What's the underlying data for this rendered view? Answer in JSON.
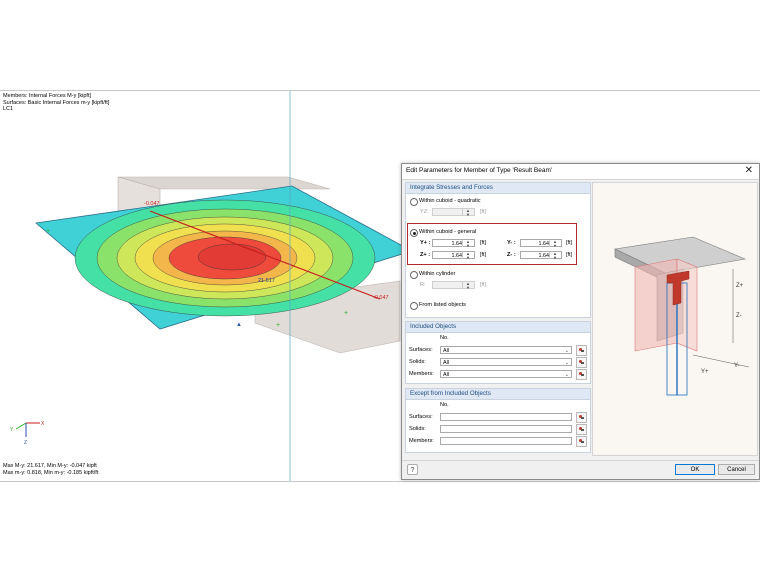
{
  "viewport": {
    "info_lines": [
      "Members: Internal Forces M-y [kipft]",
      "Surfaces: Basic Internal Forces m-y [kipft/ft]",
      "LC1"
    ],
    "labels": {
      "left_value": "-0.047",
      "center_value": "21.617",
      "right_value": "-0.047"
    },
    "footer_lines": [
      "Max M-y: 21.617, Min M-y: -0.047 kipft",
      "Max m-y: 0.818, Min m-y: -0.185 kipft/ft"
    ],
    "axes": {
      "x": "X",
      "y": "Y",
      "z": "Z"
    }
  },
  "dialog": {
    "title": "Edit Parameters for Member of Type 'Result Beam'",
    "close_glyph": "✕",
    "integrate_section": {
      "header": "Integrate Stresses and Forces",
      "quadratic": {
        "label": "Within cuboid - quadratic",
        "yz_label": "YZ:",
        "unit": "[ft]"
      },
      "general": {
        "label": "Within cuboid - general",
        "yplus_label": "Y+ :",
        "yplus_value": "1.64",
        "yplus_unit": "[ft]",
        "yminus_label": "Y- :",
        "yminus_value": "1.64",
        "yminus_unit": "[ft]",
        "zplus_label": "Z+ :",
        "zplus_value": "1.64",
        "zplus_unit": "[ft]",
        "zminus_label": "Z- :",
        "zminus_value": "1.64",
        "zminus_unit": "[ft]"
      },
      "cylinder": {
        "label": "Within cylinder",
        "r_label": "R:",
        "unit": "[ft]"
      },
      "listed": {
        "label": "From listed objects"
      }
    },
    "included_section": {
      "header": "Included Objects",
      "no_label": "No.",
      "surfaces_label": "Surfaces:",
      "surfaces_value": "All",
      "solids_label": "Solids:",
      "solids_value": "All",
      "members_label": "Members:",
      "members_value": "All"
    },
    "except_section": {
      "header": "Except from Included Objects",
      "no_label": "No.",
      "surfaces_label": "Surfaces:",
      "solids_label": "Solids:",
      "members_label": "Members:"
    },
    "preview": {
      "zplus": "Z+",
      "zminus": "Z-",
      "yplus": "Y+",
      "yminus": "Y-"
    },
    "buttons": {
      "ok": "OK",
      "cancel": "Cancel",
      "help": "?"
    }
  }
}
